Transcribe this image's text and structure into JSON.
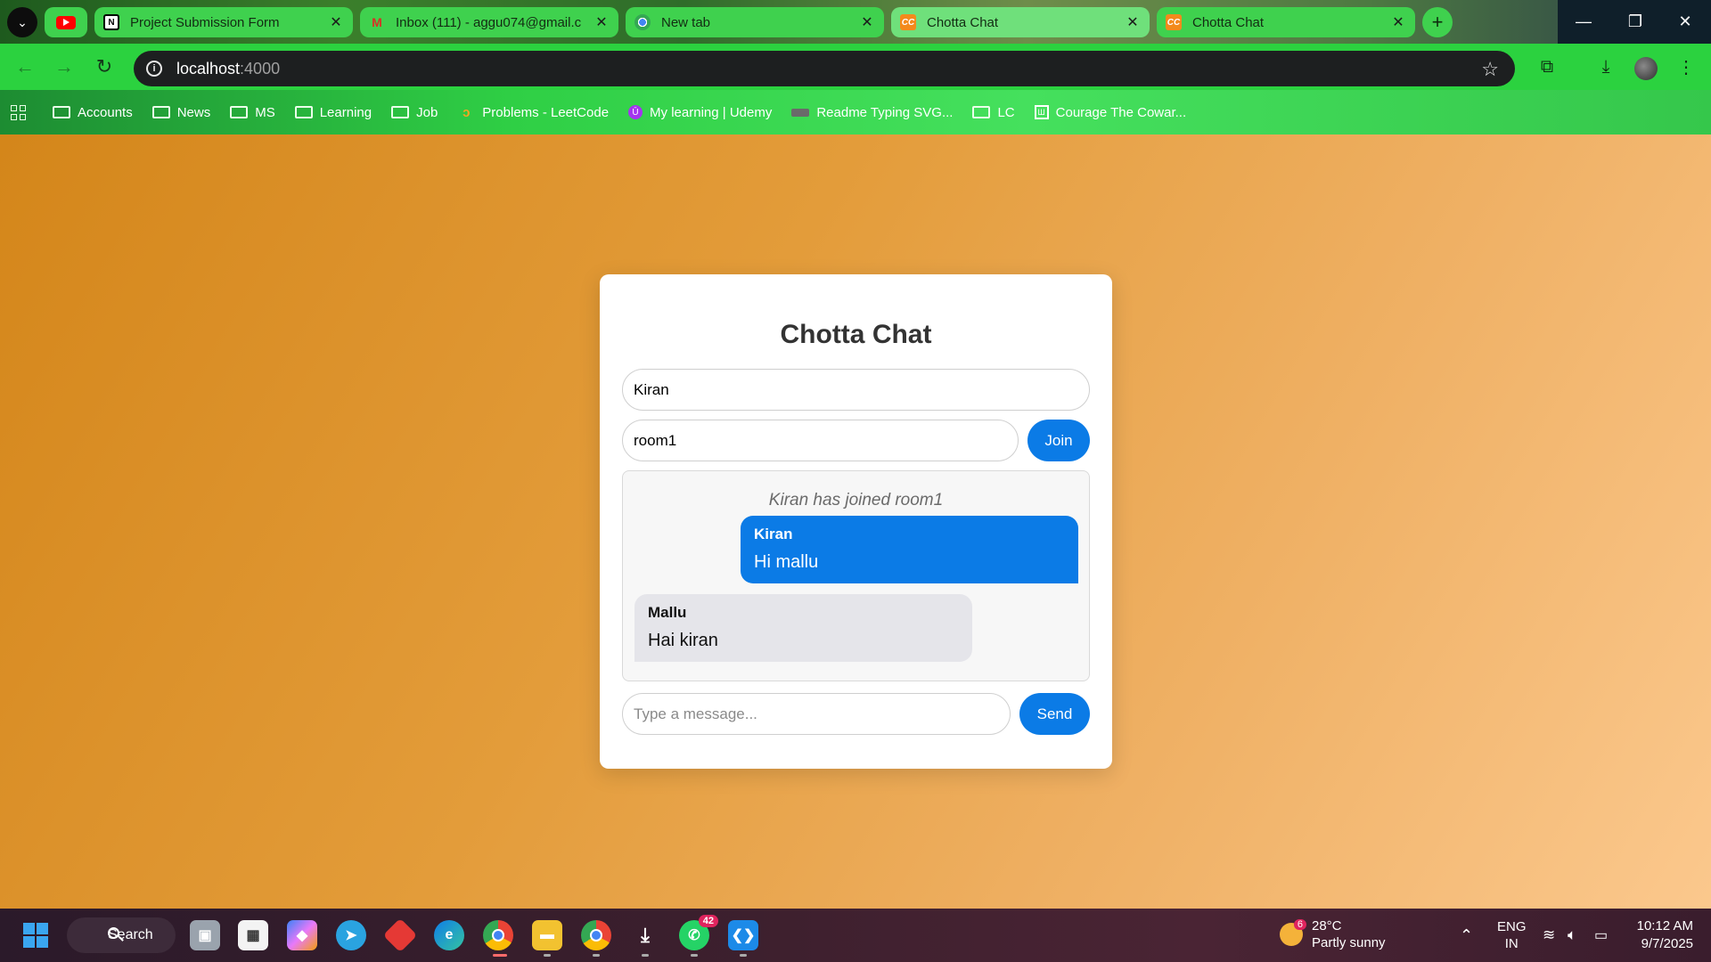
{
  "browser": {
    "tabs": [
      {
        "title": "Project Submission Form",
        "favicon": "notion-icon"
      },
      {
        "title": "Inbox (111) - aggu074@gmail.c",
        "favicon": "gmail-icon"
      },
      {
        "title": "New tab",
        "favicon": "chrome-icon"
      },
      {
        "title": "Chotta Chat",
        "favicon": "chotta-chat-icon"
      },
      {
        "title": "Chotta Chat",
        "favicon": "chotta-chat-icon"
      }
    ],
    "favicon_text": {
      "notion": "N",
      "gmail": "M",
      "chotta": "CC"
    },
    "address": {
      "host": "localhost",
      "port": ":4000"
    },
    "bookmarks": [
      {
        "label": "Accounts",
        "icon": "folder-icon"
      },
      {
        "label": "News",
        "icon": "folder-icon"
      },
      {
        "label": "MS",
        "icon": "folder-icon"
      },
      {
        "label": "Learning",
        "icon": "folder-icon"
      },
      {
        "label": "Job",
        "icon": "folder-icon"
      },
      {
        "label": "Problems - LeetCode",
        "icon": "leetcode-icon"
      },
      {
        "label": "My learning | Udemy",
        "icon": "udemy-icon"
      },
      {
        "label": "Readme Typing SVG...",
        "icon": "keyboard-icon"
      },
      {
        "label": "LC",
        "icon": "folder-icon"
      },
      {
        "label": "Courage The Cowar...",
        "icon": "building-icon"
      }
    ]
  },
  "app": {
    "title": "Chotta Chat",
    "name_input": {
      "value": "Kiran"
    },
    "room_input": {
      "value": "room1"
    },
    "join_label": "Join",
    "system_message": "Kiran has joined room1",
    "messages": [
      {
        "sender": "Kiran",
        "text": "Hi mallu",
        "own": true
      },
      {
        "sender": "Mallu",
        "text": "Hai kiran",
        "own": false
      }
    ],
    "message_input": {
      "placeholder": "Type a message..."
    },
    "send_label": "Send"
  },
  "taskbar": {
    "search_label": "Search",
    "whatsapp_badge": "42",
    "weather": {
      "badge": "6",
      "temp": "28°C",
      "desc": "Partly sunny"
    },
    "lang": {
      "line1": "ENG",
      "line2": "IN"
    },
    "clock": {
      "time": "10:12 AM",
      "date": "9/7/2025"
    }
  },
  "colors": {
    "accent": "#0b7be6",
    "page_gradient_start": "#d4861a",
    "page_gradient_end": "#fbc88d",
    "tab_green": "#3fd14e"
  }
}
